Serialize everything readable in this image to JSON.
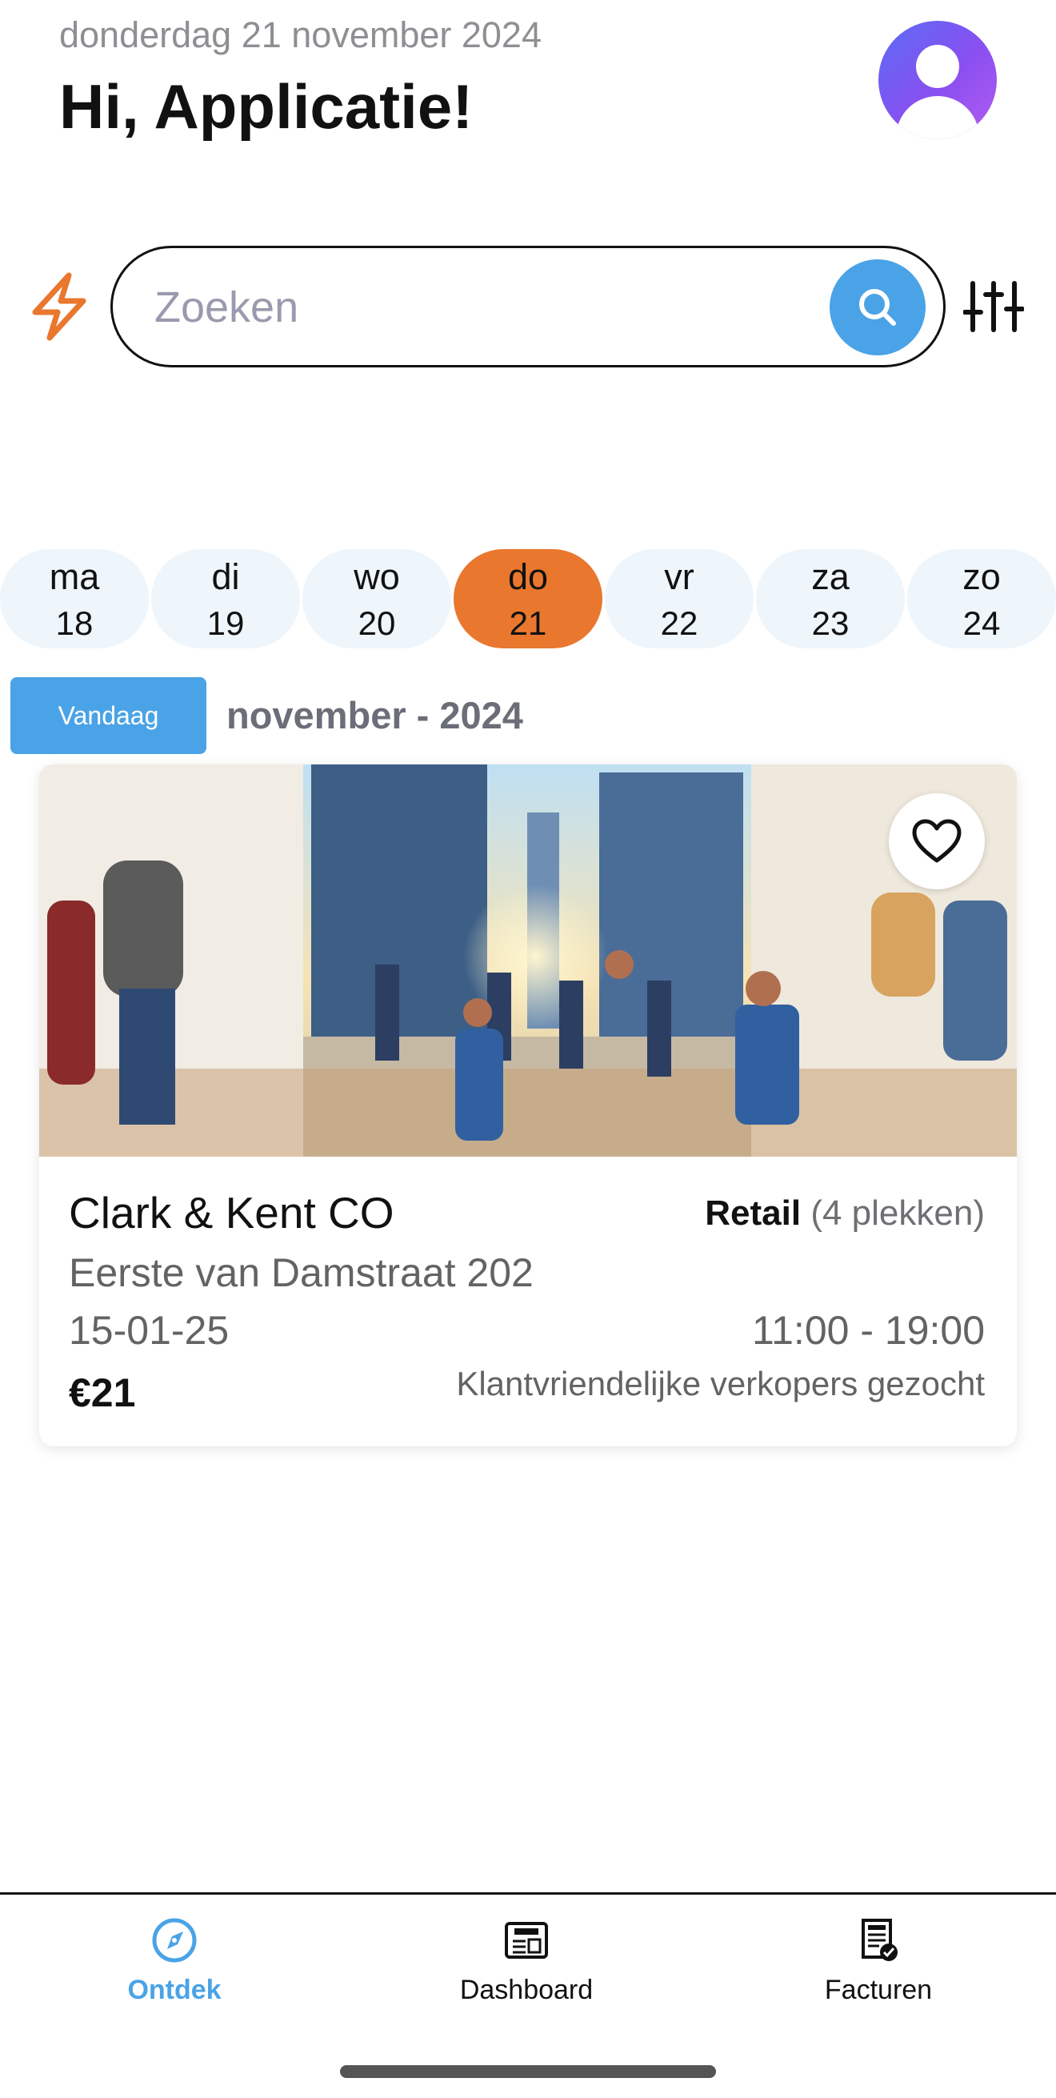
{
  "header": {
    "date": "donderdag 21 november 2024",
    "greeting": "Hi, Applicatie!"
  },
  "search": {
    "placeholder": "Zoeken",
    "value": ""
  },
  "week": {
    "days": [
      {
        "name": "ma",
        "num": "18",
        "active": false
      },
      {
        "name": "di",
        "num": "19",
        "active": false
      },
      {
        "name": "wo",
        "num": "20",
        "active": false
      },
      {
        "name": "do",
        "num": "21",
        "active": true
      },
      {
        "name": "vr",
        "num": "22",
        "active": false
      },
      {
        "name": "za",
        "num": "23",
        "active": false
      },
      {
        "name": "zo",
        "num": "24",
        "active": false
      }
    ],
    "today_label": "Vandaag",
    "month_label": "november - 2024"
  },
  "job_card": {
    "company": "Clark & Kent CO",
    "category": "Retail",
    "spots": "(4 plekken)",
    "address": "Eerste van Damstraat 202",
    "date": "15-01-25",
    "time": "11:00 - 19:00",
    "price": "€21",
    "description": "Klantvriendelijke verkopers gezocht"
  },
  "tabbar": {
    "tabs": [
      {
        "label": "Ontdek",
        "icon": "compass-icon",
        "active": true
      },
      {
        "label": "Dashboard",
        "icon": "jobs-newspaper-icon",
        "active": false
      },
      {
        "label": "Facturen",
        "icon": "invoice-icon",
        "active": false
      }
    ]
  },
  "colors": {
    "accent_blue": "#4aa3e6",
    "accent_orange": "#e9772e",
    "day_bg": "#eef5fb"
  }
}
